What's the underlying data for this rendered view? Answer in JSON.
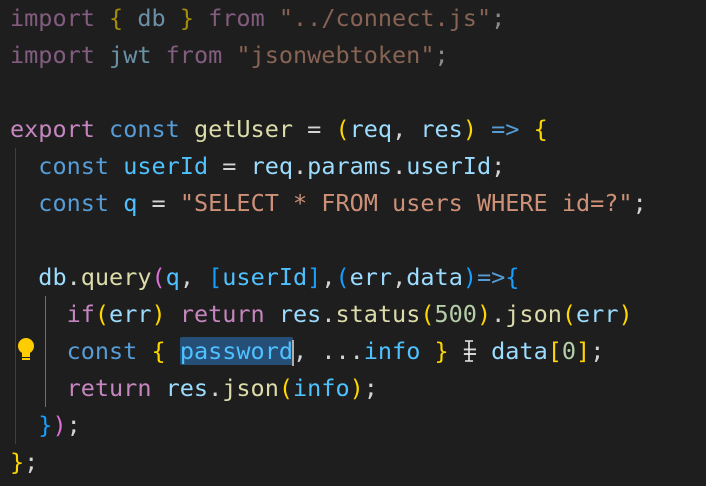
{
  "editor": {
    "language": "javascript",
    "theme_background": "#1e1e1e",
    "selection_color": "#264f78",
    "selected_text": "password",
    "lightbulb_icon": "lightbulb-icon",
    "lines": [
      "import { db } from \"../connect.js\";",
      "import jwt from \"jsonwebtoken\";",
      "",
      "export const getUser = (req, res) => {",
      "  const userId = req.params.userId;",
      "  const q = \"SELECT * FROM users WHERE id=?\";",
      "",
      "  db.query(q, [userId],(err,data)=>{",
      "    if(err) return res.status(500).json(err)",
      "    const { password, ...info } = data[0];",
      "    return res.json(info);",
      "  });",
      "};"
    ]
  },
  "tokens": {
    "l1": {
      "import": "import",
      "ob": "{",
      "db": "db",
      "cb": "}",
      "from": "from",
      "path": "\"../connect.js\"",
      "semi": ";"
    },
    "l2": {
      "import": "import",
      "jwt": "jwt",
      "from": "from",
      "path": "\"jsonwebtoken\"",
      "semi": ";"
    },
    "l4": {
      "export": "export",
      "const": "const",
      "getUser": "getUser",
      "eq": "=",
      "op": "(",
      "req": "req",
      "comma": ",",
      "res": "res",
      "cp": ")",
      "arrow": "=>",
      "ob": "{"
    },
    "l5": {
      "const": "const",
      "userId": "userId",
      "eq": "=",
      "req": "req",
      "dot1": ".",
      "params": "params",
      "dot2": ".",
      "userId2": "userId",
      "semi": ";"
    },
    "l6": {
      "const": "const",
      "q": "q",
      "eq": "=",
      "sql": "\"SELECT * FROM users WHERE id=?\"",
      "semi": ";"
    },
    "l8": {
      "db": "db",
      "dot": ".",
      "query": "query",
      "op": "(",
      "q": "q",
      "comma": ",",
      "osq": "[",
      "userId": "userId",
      "csq": "]",
      "comma2": ",",
      "op2": "(",
      "err": "err",
      "comma3": ",",
      "data": "data",
      "cp2": ")",
      "arrow": "=>",
      "ob": "{"
    },
    "l9": {
      "if": "if",
      "op": "(",
      "err": "err",
      "cp": ")",
      "return": "return",
      "res": "res",
      "dot": ".",
      "status": "status",
      "op2": "(",
      "code": "500",
      "cp2": ")",
      "dot2": ".",
      "json": "json",
      "op3": "(",
      "err2": "err",
      "cp3": ")"
    },
    "l10": {
      "const": "const",
      "ob": "{",
      "password": "password",
      "comma": ",",
      "spread": "...",
      "info": "info",
      "cb": "}",
      "eq": "=",
      "data": "data",
      "osq": "[",
      "idx": "0",
      "csq": "]",
      "semi": ";"
    },
    "l11": {
      "return": "return",
      "res": "res",
      "dot": ".",
      "json": "json",
      "op": "(",
      "info": "info",
      "cp": ")",
      "semi": ";"
    },
    "l12": {
      "cb": "}",
      "cp": ")",
      "semi": ";"
    },
    "l13": {
      "cb": "}",
      "semi": ";"
    }
  }
}
